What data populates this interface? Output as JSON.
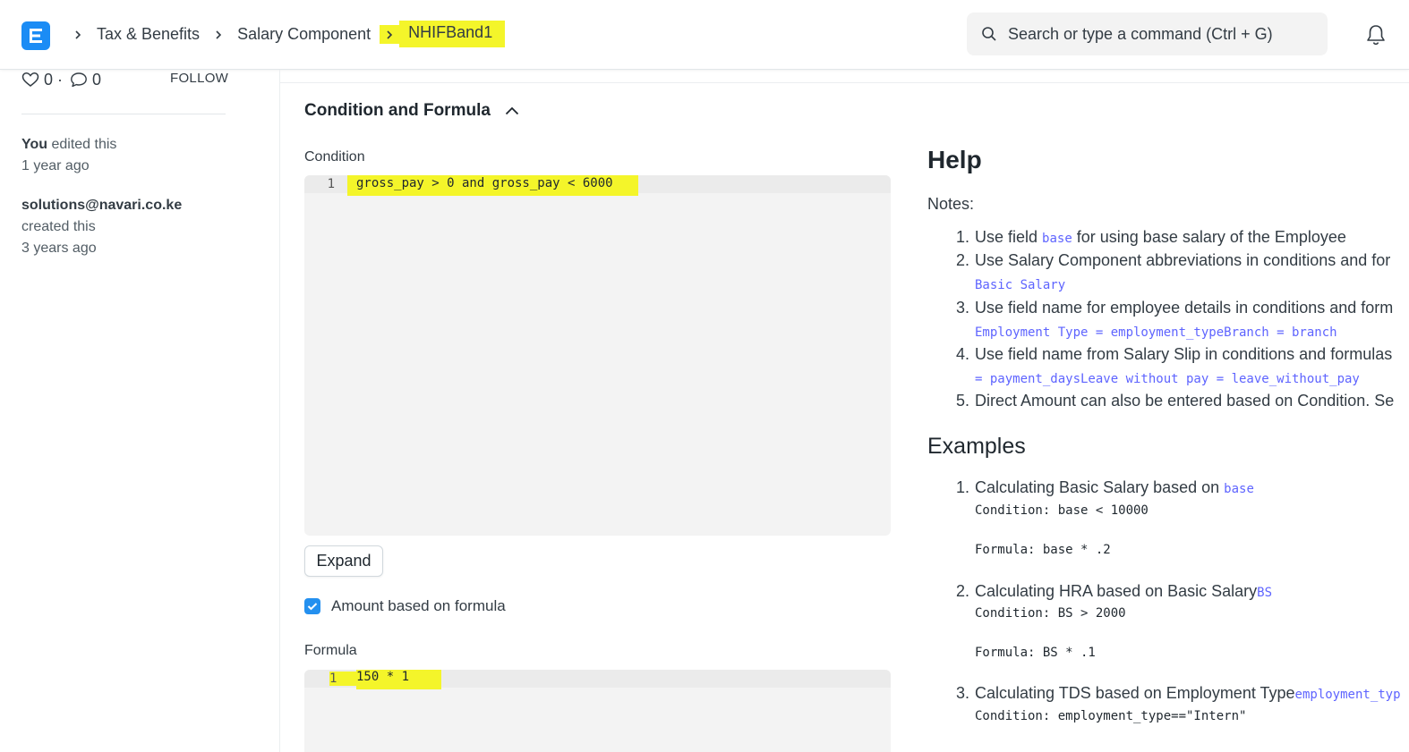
{
  "navbar": {
    "logo_letter": "E",
    "breadcrumbs": [
      "Tax & Benefits",
      "Salary Component",
      "NHIFBand1"
    ],
    "search_placeholder": "Search or type a command (Ctrl + G)"
  },
  "sidebar": {
    "likes": "0",
    "dot": "·",
    "comments": "0",
    "follow_label": "FOLLOW",
    "activity": [
      {
        "actor": "You",
        "action": "edited this",
        "time": "1 year ago"
      },
      {
        "actor": "solutions@navari.co.ke",
        "action": "created this",
        "time": "3 years ago"
      }
    ]
  },
  "main": {
    "section_title": "Condition and Formula",
    "condition_label": "Condition",
    "condition_line_number": "1",
    "condition_code": "gross_pay > 0 and gross_pay < 6000",
    "expand_label": "Expand",
    "amount_based_on_formula_label": "Amount based on formula",
    "amount_based_on_formula_checked": true,
    "formula_label": "Formula",
    "formula_line_number": "1",
    "formula_code": "150 * 1"
  },
  "help": {
    "title": "Help",
    "notes_label": "Notes:",
    "notes": [
      {
        "num": "1.",
        "pre": "Use field ",
        "code": "base",
        "post": " for using base salary of the Employee"
      },
      {
        "num": "2.",
        "text": "Use Salary Component abbreviations in conditions and for",
        "sub": "Basic Salary"
      },
      {
        "num": "3.",
        "text": "Use field name for employee details in conditions and form",
        "sub": "Employment Type = employment_typeBranch = branch"
      },
      {
        "num": "4.",
        "text": "Use field name from Salary Slip in conditions and formulas",
        "sub": "= payment_daysLeave without pay = leave_without_pay"
      },
      {
        "num": "5.",
        "text": "Direct Amount can also be entered based on Condition. Se"
      }
    ],
    "examples_title": "Examples",
    "examples": [
      {
        "num": "1.",
        "text": "Calculating Basic Salary based on ",
        "code": "base",
        "condition": "Condition: base < 10000",
        "formula": "Formula: base * .2"
      },
      {
        "num": "2.",
        "text": "Calculating HRA based on Basic Salary",
        "code": "BS",
        "condition": "Condition: BS > 2000",
        "formula": "Formula: BS * .1"
      },
      {
        "num": "3.",
        "text": "Calculating TDS based on Employment Type",
        "code": "employment_typ",
        "condition": "Condition: employment_type==\"Intern\""
      }
    ]
  },
  "colors": {
    "brand": "#1b8cf5",
    "highlight": "#f4f52a",
    "code_accent": "#5e64ff",
    "checkbox": "#2490ef"
  }
}
